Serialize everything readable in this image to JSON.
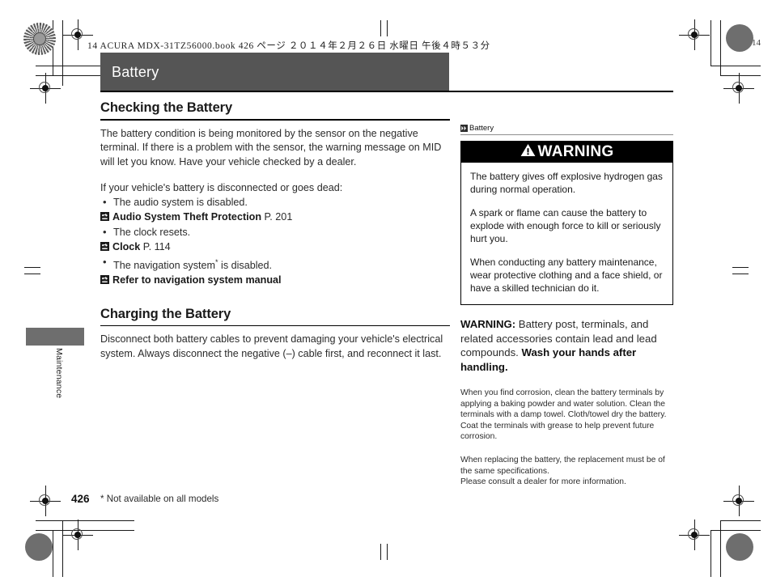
{
  "print_header": "14 ACURA MDX-31TZ56000.book   426 ページ   ２０１４年２月２６日   水曜日   午後４時５３分",
  "edge_mark_number": "14",
  "chapter": {
    "title": "Battery"
  },
  "main": {
    "section1": {
      "heading": "Checking the Battery",
      "paragraph1": "The battery condition is being monitored by the sensor on the negative terminal. If there is a problem with the sensor, the warning message on MID will let you know. Have your vehicle checked by a dealer.",
      "paragraph2": "If your vehicle's battery is disconnected or goes dead:",
      "bullets": [
        {
          "text": "The audio system is disabled.",
          "ref_label": "Audio System Theft Protection",
          "ref_page": "P. 201"
        },
        {
          "text": "The clock resets.",
          "ref_label": "Clock",
          "ref_page": "P. 114"
        },
        {
          "text": "The navigation system",
          "text_suffix": " is disabled.",
          "asterisk": "*",
          "ref_label": "Refer to navigation system manual",
          "ref_page": ""
        }
      ]
    },
    "section2": {
      "heading": "Charging the Battery",
      "paragraph1": "Disconnect both battery cables to prevent damaging your vehicle's electrical system. Always disconnect the negative (–) cable first, and reconnect it last."
    }
  },
  "sidebar": {
    "label": "Battery",
    "warning_box": {
      "banner": "WARNING",
      "paragraphs": [
        "The battery gives off explosive hydrogen gas during normal operation.",
        "A spark or flame can cause the battery to explode with enough force to kill or seriously hurt you.",
        "When conducting any battery maintenance, wear protective clothing and a face shield, or have a skilled technician do it."
      ]
    },
    "warning_after": {
      "bold_lead": "WARNING:",
      "body": " Battery post, terminals, and related accessories contain lead and lead compounds.",
      "bold_tail": "Wash your hands after handling."
    },
    "notes": [
      "When you find corrosion, clean the battery terminals by applying a baking powder and water solution. Clean the terminals with a damp towel. Cloth/towel dry the battery. Coat the terminals with grease to help prevent future corrosion.",
      "When replacing the battery, the replacement must be of the same specifications.\nPlease consult a dealer for more information."
    ]
  },
  "edge_tab": {
    "label": "Maintenance"
  },
  "footer": {
    "page_number": "426",
    "footnote": "* Not available on all models"
  },
  "colors": {
    "title_bar": "#555555",
    "warning_banner": "#000000",
    "tab_block": "#6e6e6e"
  }
}
